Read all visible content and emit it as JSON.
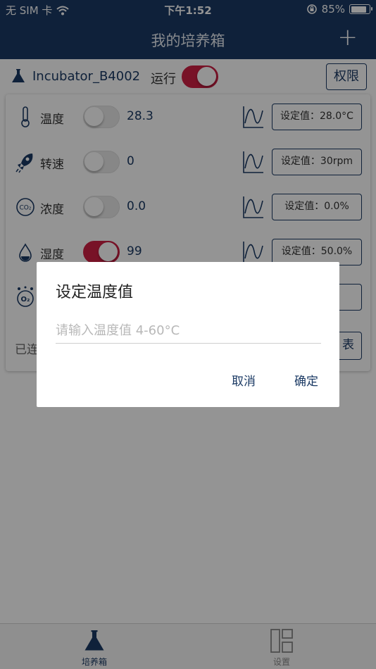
{
  "status_bar": {
    "carrier": "无 SIM 卡",
    "time": "下午1:52",
    "battery": "85%",
    "battery_level": 0.85
  },
  "nav": {
    "title": "我的培养箱",
    "add_icon": "plus-icon"
  },
  "device": {
    "name": "Incubator_B4002",
    "run_label": "运行",
    "run_on": true,
    "permission_label": "权限"
  },
  "sensors": [
    {
      "label": "温度",
      "value": "28.3",
      "on": false,
      "setpoint": "设定值：28.0°C",
      "icon": "thermometer-icon"
    },
    {
      "label": "转速",
      "value": "0",
      "on": false,
      "setpoint": "设定值：30rpm",
      "icon": "rocket-icon"
    },
    {
      "label": "浓度",
      "value": "0.0",
      "on": false,
      "setpoint": "设定值：0.0%",
      "icon": "co2-icon"
    },
    {
      "label": "湿度",
      "value": "99",
      "on": true,
      "setpoint": "设定值：50.0%",
      "icon": "water-drop-icon"
    },
    {
      "label": "",
      "value": "",
      "on": false,
      "setpoint": "",
      "icon": "o2-icon"
    }
  ],
  "card_footer": {
    "left": "已连",
    "right": "表"
  },
  "dialog": {
    "title": "设定温度值",
    "input_value": "",
    "input_placeholder": "请输入温度值 4-60°C",
    "cancel_label": "取消",
    "confirm_label": "确定"
  },
  "tabs": [
    {
      "label": "培养箱",
      "icon": "flask-icon",
      "active": true
    },
    {
      "label": "设置",
      "icon": "layout-icon",
      "active": false
    }
  ],
  "colors": {
    "primary": "#1b3a64",
    "toggle_on": "#cf1f44"
  }
}
